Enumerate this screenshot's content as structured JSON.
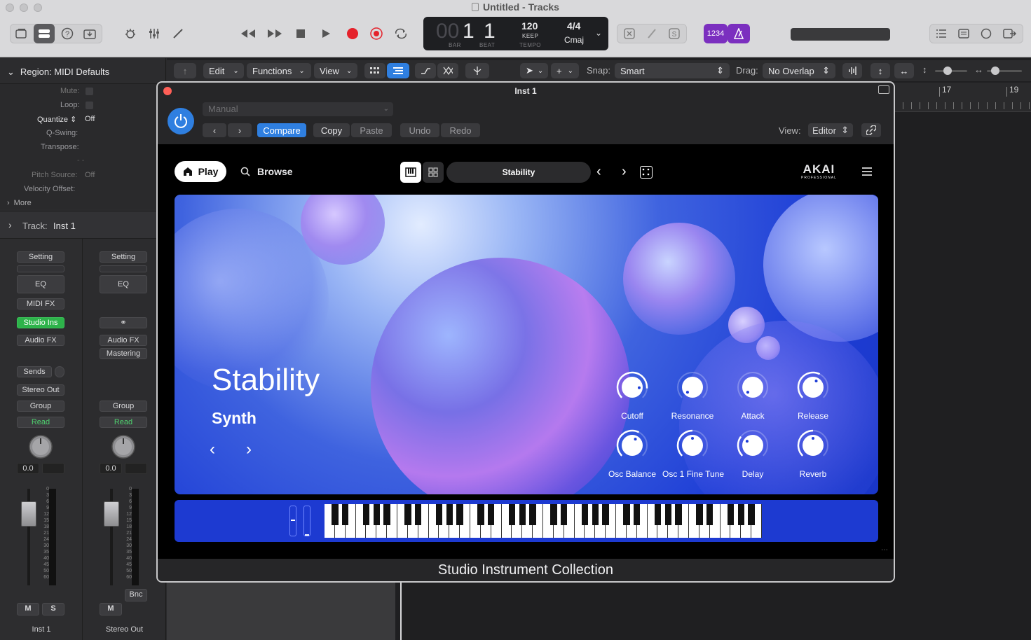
{
  "window": {
    "title": "Untitled - Tracks"
  },
  "lcd": {
    "bar_dim": "00",
    "bar": "1",
    "beat": "1",
    "bar_label": "BAR",
    "beat_label": "BEAT",
    "tempo": "120",
    "keep": "KEEP",
    "tempo_label": "TEMPO",
    "signature": "4/4",
    "key": "Cmaj"
  },
  "toolbar": {
    "count_in": "1234"
  },
  "inspector": {
    "region_title": "Region: MIDI Defaults",
    "rows": [
      {
        "label": "Mute:",
        "value": ""
      },
      {
        "label": "Loop:",
        "value": ""
      },
      {
        "label": "Quantize",
        "value": "Off"
      },
      {
        "label": "Q-Swing:",
        "value": ""
      },
      {
        "label": "Transpose:",
        "value": ""
      },
      {
        "label": "Pitch Source:",
        "value": "Off"
      },
      {
        "label": "Velocity Offset:",
        "value": ""
      }
    ],
    "more": "More",
    "track_label": "Track:",
    "track_name": "Inst 1"
  },
  "strips": [
    {
      "setting": "Setting",
      "eq": "EQ",
      "midi_fx": "MIDI FX",
      "instrument": "Studio Ins",
      "audio_fx": "Audio FX",
      "sends": "Sends",
      "output": "Stereo Out",
      "group": "Group",
      "automation": "Read",
      "volume": "0.0",
      "mute": "M",
      "solo": "S",
      "name": "Inst 1"
    },
    {
      "setting": "Setting",
      "eq": "EQ",
      "audio_fx": "Audio FX",
      "mastering": "Mastering",
      "group": "Group",
      "automation": "Read",
      "volume": "0.0",
      "mute": "M",
      "bounce": "Bnc",
      "name": "Stereo Out"
    }
  ],
  "fader_scale": [
    "0",
    "3",
    "6",
    "9",
    "12",
    "15",
    "18",
    "21",
    "24",
    "30",
    "35",
    "40",
    "45",
    "50",
    "60"
  ],
  "arrange_toolbar": {
    "edit": "Edit",
    "functions": "Functions",
    "view": "View",
    "snap_label": "Snap:",
    "snap_value": "Smart",
    "drag_label": "Drag:",
    "drag_value": "No Overlap"
  },
  "ruler": {
    "marks": [
      "17",
      "19"
    ]
  },
  "plugin": {
    "title": "Inst 1",
    "preset": "Manual",
    "compare": "Compare",
    "copy": "Copy",
    "paste": "Paste",
    "undo": "Undo",
    "redo": "Redo",
    "view_label": "View:",
    "view_value": "Editor",
    "footer": "Studio Instrument Collection"
  },
  "instrument": {
    "play": "Play",
    "browse": "Browse",
    "preset_name": "Stability",
    "brand": "AKAI",
    "brand_sub": "PROFESSIONAL",
    "hero_title": "Stability",
    "hero_category": "Synth",
    "knobs": [
      {
        "label": "Cutoff",
        "value": 0.85
      },
      {
        "label": "Resonance",
        "value": 0.0
      },
      {
        "label": "Attack",
        "value": 0.0
      },
      {
        "label": "Release",
        "value": 0.6
      },
      {
        "label": "Osc Balance",
        "value": 0.6
      },
      {
        "label": "Osc 1 Fine Tune",
        "value": 0.5
      },
      {
        "label": "Delay",
        "value": 0.3
      },
      {
        "label": "Reverb",
        "value": 0.5
      }
    ],
    "pitch_wheel": 0.5,
    "mod_wheel": 0.0
  },
  "colors": {
    "accent": "#2f7fe0",
    "hero_blue": "#1e3ed6",
    "record": "#e5222b",
    "green": "#2db34a",
    "purple": "#8a2be2"
  }
}
